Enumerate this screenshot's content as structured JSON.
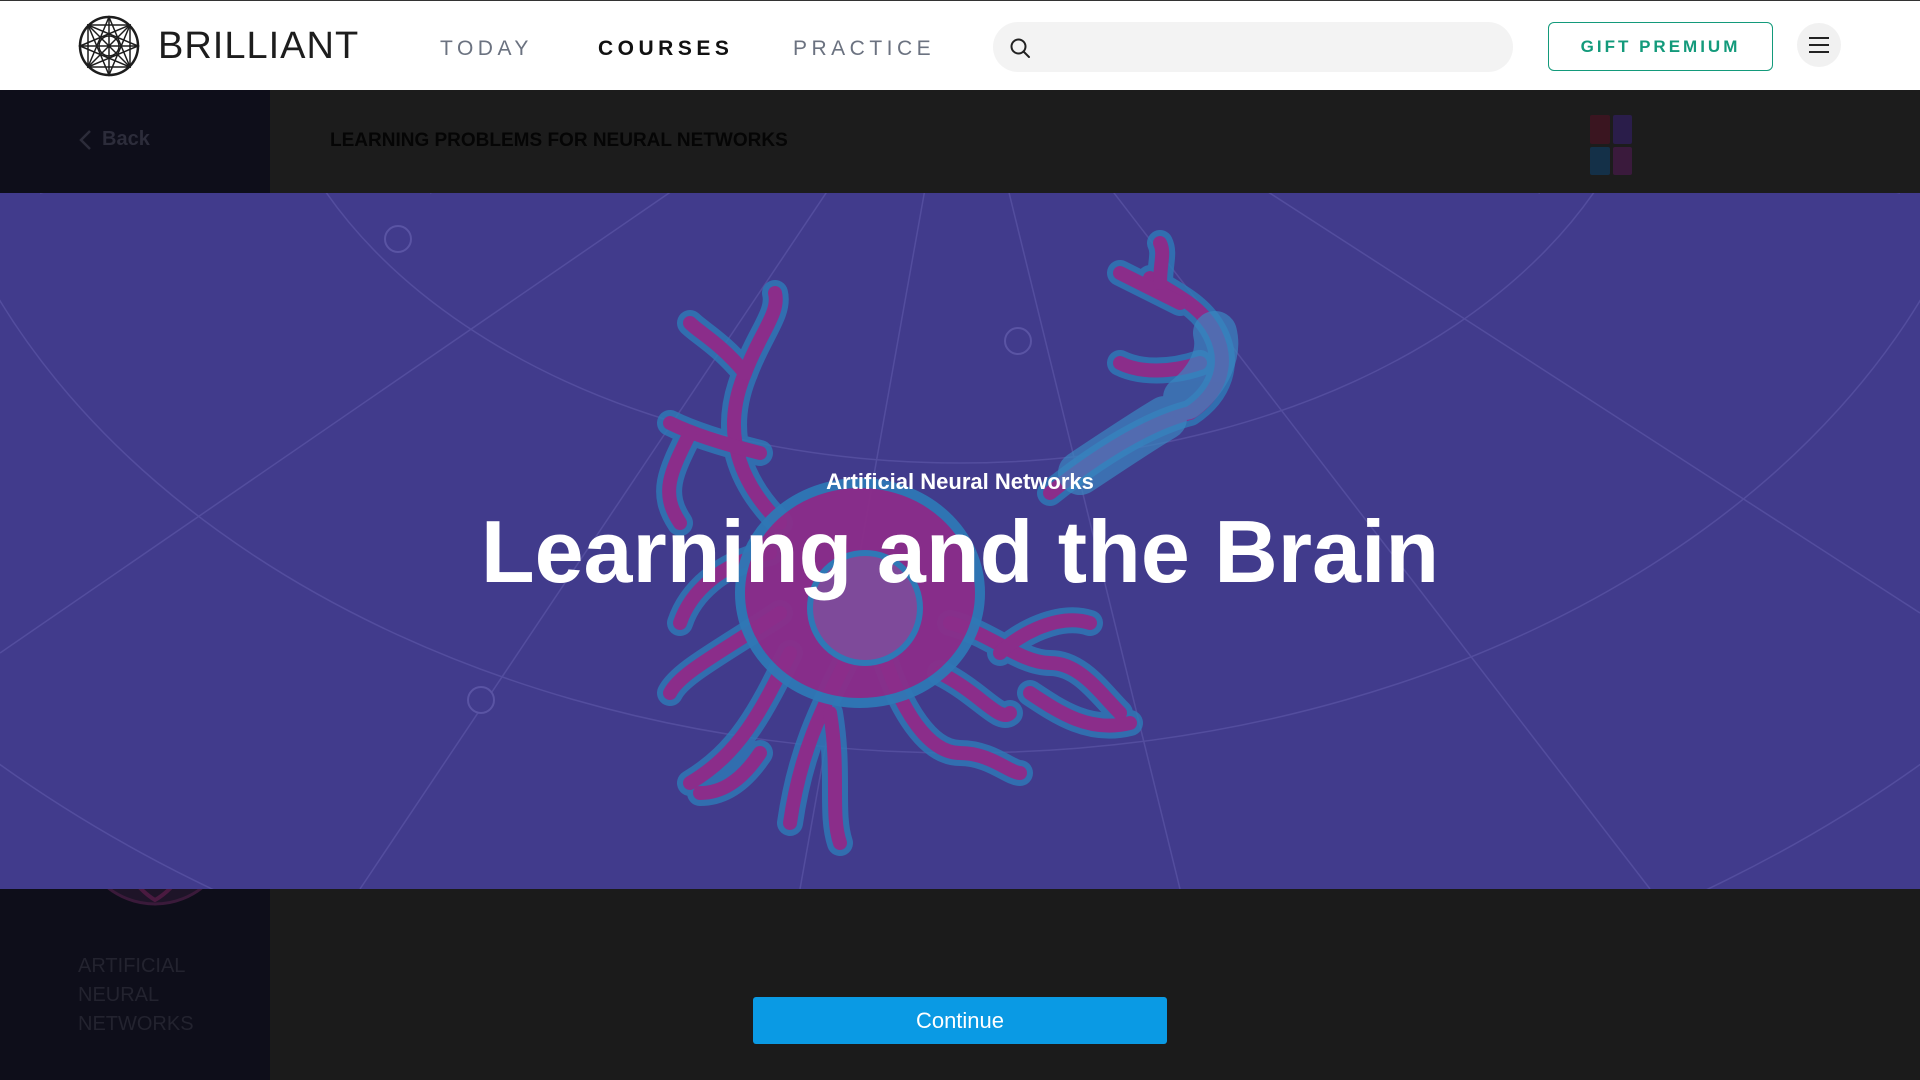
{
  "brand": {
    "name": "BRILLIANT",
    "icon": "brilliant-logo-icon"
  },
  "nav": {
    "links": [
      {
        "label": "TODAY",
        "active": false
      },
      {
        "label": "COURSES",
        "active": true
      },
      {
        "label": "PRACTICE",
        "active": false
      }
    ],
    "search": {
      "placeholder": "",
      "icon": "search-icon"
    },
    "gift_label": "GIFT PREMIUM",
    "menu_icon": "hamburger-menu-icon"
  },
  "sidebar": {
    "back_label": "Back",
    "course_name": "ARTIFICIAL NEURAL NETWORKS"
  },
  "course_header": {
    "title": "LEARNING PROBLEMS FOR NEURAL NETWORKS"
  },
  "banner": {
    "subtitle": "Artificial Neural Networks",
    "title": "Learning and the Brain",
    "background_color": "#413b8c",
    "illustration": "neuron-illustration"
  },
  "continue_label": "Continue",
  "colors": {
    "accent_green": "#139a7b",
    "continue_blue": "#0a9ae4",
    "neuron_magenta": "#8b2d8a",
    "neuron_outline": "#2f78b6"
  }
}
